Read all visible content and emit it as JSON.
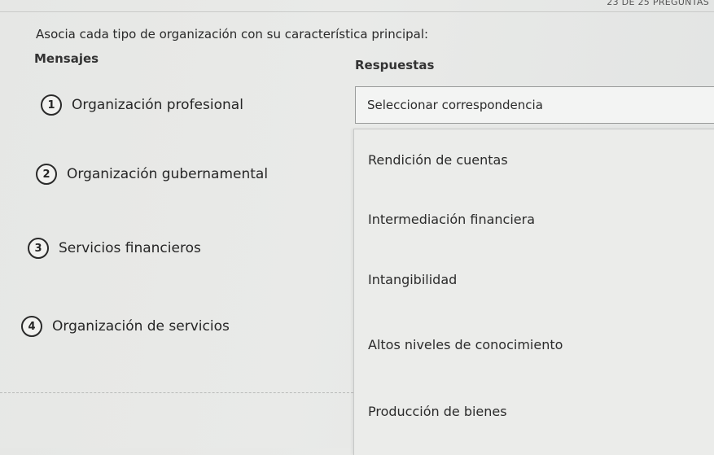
{
  "header": {
    "counter": "23 DE 25 PREGUNTAS"
  },
  "question": {
    "instruction": "Asocia cada tipo de organización con su característica principal:",
    "left_header": "Mensajes",
    "right_header": "Respuestas"
  },
  "messages": [
    {
      "number": "1",
      "label": "Organización profesional"
    },
    {
      "number": "2",
      "label": "Organización gubernamental"
    },
    {
      "number": "3",
      "label": "Servicios financieros"
    },
    {
      "number": "4",
      "label": "Organización de servicios"
    }
  ],
  "select": {
    "value": "Seleccionar correspondencia"
  },
  "options": [
    "Rendición de cuentas",
    "Intermediación financiera",
    "Intangibilidad",
    "Altos niveles de conocimiento",
    "Producción de bienes"
  ]
}
